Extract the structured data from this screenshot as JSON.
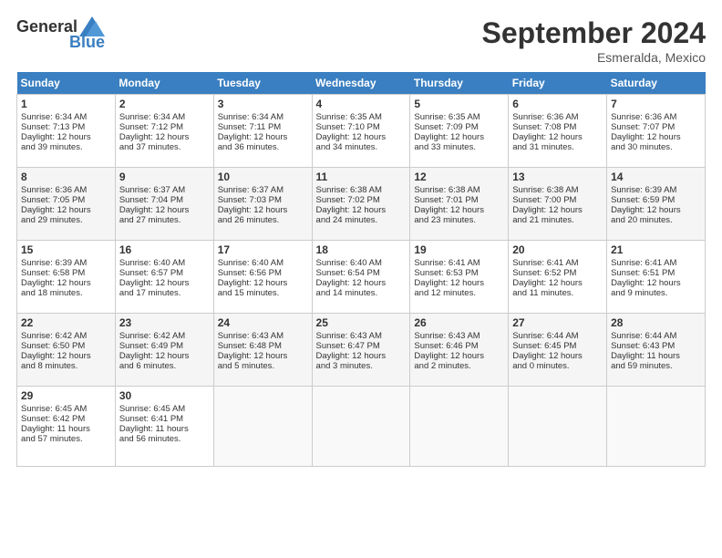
{
  "header": {
    "logo_general": "General",
    "logo_blue": "Blue",
    "month_title": "September 2024",
    "subtitle": "Esmeralda, Mexico"
  },
  "days_of_week": [
    "Sunday",
    "Monday",
    "Tuesday",
    "Wednesday",
    "Thursday",
    "Friday",
    "Saturday"
  ],
  "weeks": [
    [
      {
        "day": "1",
        "sunrise": "6:34 AM",
        "sunset": "7:13 PM",
        "daylight": "12 hours and 39 minutes."
      },
      {
        "day": "2",
        "sunrise": "6:34 AM",
        "sunset": "7:12 PM",
        "daylight": "12 hours and 37 minutes."
      },
      {
        "day": "3",
        "sunrise": "6:34 AM",
        "sunset": "7:11 PM",
        "daylight": "12 hours and 36 minutes."
      },
      {
        "day": "4",
        "sunrise": "6:35 AM",
        "sunset": "7:10 PM",
        "daylight": "12 hours and 34 minutes."
      },
      {
        "day": "5",
        "sunrise": "6:35 AM",
        "sunset": "7:09 PM",
        "daylight": "12 hours and 33 minutes."
      },
      {
        "day": "6",
        "sunrise": "6:36 AM",
        "sunset": "7:08 PM",
        "daylight": "12 hours and 31 minutes."
      },
      {
        "day": "7",
        "sunrise": "6:36 AM",
        "sunset": "7:07 PM",
        "daylight": "12 hours and 30 minutes."
      }
    ],
    [
      {
        "day": "8",
        "sunrise": "6:36 AM",
        "sunset": "7:05 PM",
        "daylight": "12 hours and 29 minutes."
      },
      {
        "day": "9",
        "sunrise": "6:37 AM",
        "sunset": "7:04 PM",
        "daylight": "12 hours and 27 minutes."
      },
      {
        "day": "10",
        "sunrise": "6:37 AM",
        "sunset": "7:03 PM",
        "daylight": "12 hours and 26 minutes."
      },
      {
        "day": "11",
        "sunrise": "6:38 AM",
        "sunset": "7:02 PM",
        "daylight": "12 hours and 24 minutes."
      },
      {
        "day": "12",
        "sunrise": "6:38 AM",
        "sunset": "7:01 PM",
        "daylight": "12 hours and 23 minutes."
      },
      {
        "day": "13",
        "sunrise": "6:38 AM",
        "sunset": "7:00 PM",
        "daylight": "12 hours and 21 minutes."
      },
      {
        "day": "14",
        "sunrise": "6:39 AM",
        "sunset": "6:59 PM",
        "daylight": "12 hours and 20 minutes."
      }
    ],
    [
      {
        "day": "15",
        "sunrise": "6:39 AM",
        "sunset": "6:58 PM",
        "daylight": "12 hours and 18 minutes."
      },
      {
        "day": "16",
        "sunrise": "6:40 AM",
        "sunset": "6:57 PM",
        "daylight": "12 hours and 17 minutes."
      },
      {
        "day": "17",
        "sunrise": "6:40 AM",
        "sunset": "6:56 PM",
        "daylight": "12 hours and 15 minutes."
      },
      {
        "day": "18",
        "sunrise": "6:40 AM",
        "sunset": "6:54 PM",
        "daylight": "12 hours and 14 minutes."
      },
      {
        "day": "19",
        "sunrise": "6:41 AM",
        "sunset": "6:53 PM",
        "daylight": "12 hours and 12 minutes."
      },
      {
        "day": "20",
        "sunrise": "6:41 AM",
        "sunset": "6:52 PM",
        "daylight": "12 hours and 11 minutes."
      },
      {
        "day": "21",
        "sunrise": "6:41 AM",
        "sunset": "6:51 PM",
        "daylight": "12 hours and 9 minutes."
      }
    ],
    [
      {
        "day": "22",
        "sunrise": "6:42 AM",
        "sunset": "6:50 PM",
        "daylight": "12 hours and 8 minutes."
      },
      {
        "day": "23",
        "sunrise": "6:42 AM",
        "sunset": "6:49 PM",
        "daylight": "12 hours and 6 minutes."
      },
      {
        "day": "24",
        "sunrise": "6:43 AM",
        "sunset": "6:48 PM",
        "daylight": "12 hours and 5 minutes."
      },
      {
        "day": "25",
        "sunrise": "6:43 AM",
        "sunset": "6:47 PM",
        "daylight": "12 hours and 3 minutes."
      },
      {
        "day": "26",
        "sunrise": "6:43 AM",
        "sunset": "6:46 PM",
        "daylight": "12 hours and 2 minutes."
      },
      {
        "day": "27",
        "sunrise": "6:44 AM",
        "sunset": "6:45 PM",
        "daylight": "12 hours and 0 minutes."
      },
      {
        "day": "28",
        "sunrise": "6:44 AM",
        "sunset": "6:43 PM",
        "daylight": "11 hours and 59 minutes."
      }
    ],
    [
      {
        "day": "29",
        "sunrise": "6:45 AM",
        "sunset": "6:42 PM",
        "daylight": "11 hours and 57 minutes."
      },
      {
        "day": "30",
        "sunrise": "6:45 AM",
        "sunset": "6:41 PM",
        "daylight": "11 hours and 56 minutes."
      },
      null,
      null,
      null,
      null,
      null
    ]
  ]
}
